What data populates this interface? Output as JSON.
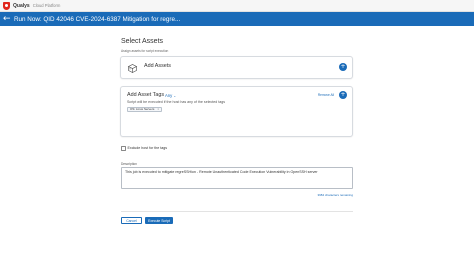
{
  "header": {
    "brand": "Qualys",
    "brand_sub": "Cloud Platform"
  },
  "titlebar": {
    "title": "Run Now: QID 42046 CVE-2024-6387 Mitigation for regre..."
  },
  "page": {
    "title": "Select Assets",
    "subtitle": "Assign assets for script execution"
  },
  "add_assets": {
    "title": "Add Assets"
  },
  "add_tags": {
    "title": "Add Asset Tags",
    "match_mode": "Any",
    "remove_all_label": "Remove All",
    "description": "Script will be executed if the host has any of the selected tags",
    "tags": [
      "OS: Linux Servers"
    ]
  },
  "exclude": {
    "label": "Exclude host for the tags",
    "checked": false
  },
  "description": {
    "label": "Description",
    "value": "This job is executed to mitigate regreSSHion - Remote Unauthenticated Code Execution Vulnerability in OpenSSH server",
    "char_remaining": "3984 characters remaining"
  },
  "actions": {
    "cancel_label": "Cancel",
    "execute_label": "Execute Script"
  },
  "colors": {
    "accent": "#1a6bb8",
    "brand_red": "#e0251b"
  },
  "icons": {
    "logo": "qualys-shield-icon",
    "back": "back-arrow-icon",
    "assets": "box-icon",
    "add": "plus-icon",
    "dropdown": "chevron-down-icon",
    "remove": "close-icon"
  }
}
